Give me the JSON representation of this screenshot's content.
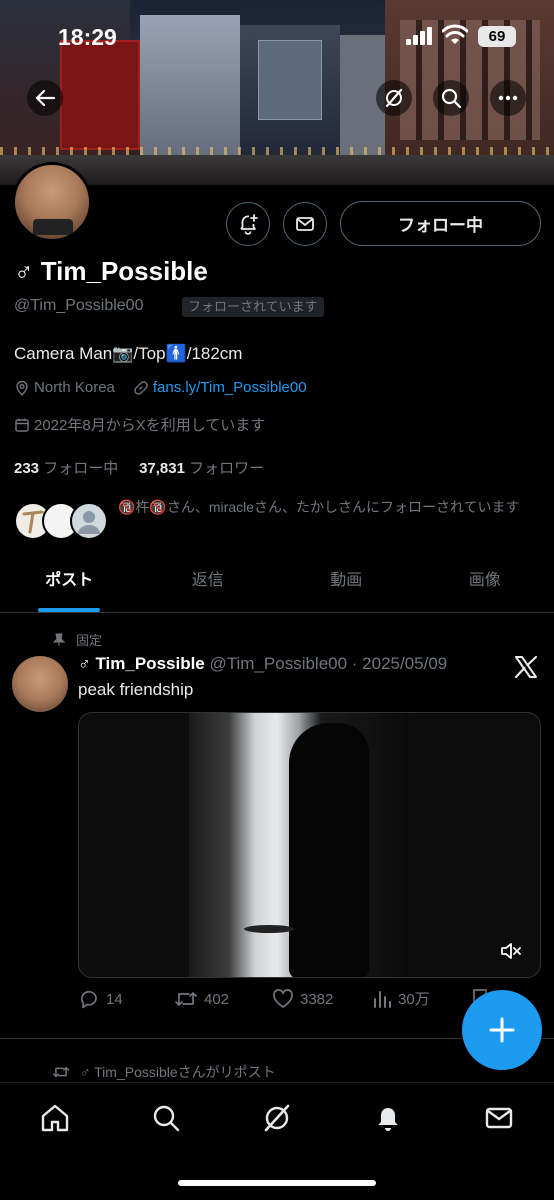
{
  "status_bar": {
    "time": "18:29",
    "battery": "69"
  },
  "profile": {
    "name": "♂ Tim_Possible",
    "handle": "@Tim_Possible00",
    "follows_you": "フォローされています",
    "follow_button": "フォロー中",
    "bio": "Camera Man📷/Top🚹/182cm",
    "location": "North Korea",
    "link": "fans.ly/Tim_Possible00",
    "joined": "2022年8月からXを利用しています",
    "following_count": "233",
    "following_label": "フォロー中",
    "followers_count": "37,831",
    "followers_label": "フォロワー",
    "mutual_text": "🔞杵🔞さん、miracleさん、たかしさんにフォローされています"
  },
  "tabs": [
    "ポスト",
    "返信",
    "動画",
    "画像"
  ],
  "pinned_post": {
    "pinned_label": "固定",
    "author_name": "♂ Tim_Possible",
    "author_handle_date": "@Tim_Possible00 · 2025/05/09",
    "text": "peak friendship",
    "replies": "14",
    "reposts": "402",
    "likes": "3382",
    "views": "30万"
  },
  "next_post": {
    "repost_label": "♂ Tim_Possibleさんがリポスト"
  },
  "colors": {
    "accent": "#1d9bf0",
    "background": "#000000",
    "muted": "#71767b"
  }
}
